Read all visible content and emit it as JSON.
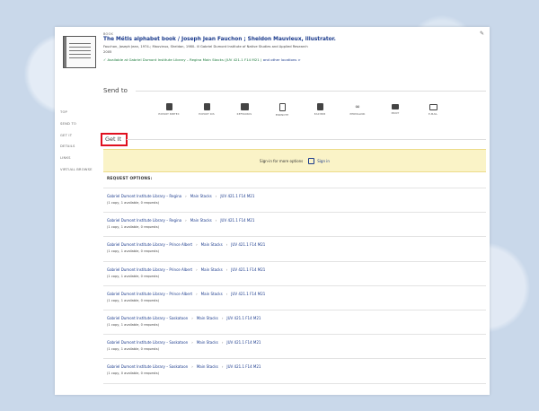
{
  "record": {
    "type": "BOOK",
    "title": "The Métis alphabet book / Joseph Jean Fauchon ; Sheldon Mauvieux, illustrator.",
    "authors": "Fauchon, Joseph Jean, 1974-; Mauvieux, Sheldon, 1980- ill Gabriel Dumont Institute of Native Studies and Applied Research",
    "year": "2005",
    "availability_prefix": "Available at Gabriel Dumont Institute Library – Regina  Main Stacks (JUV 421.1 F14 M21 )",
    "availability_link": "and other locations >"
  },
  "nav": [
    "TOP",
    "SEND TO",
    "GET IT",
    "DETAILS",
    "LINKS",
    "VIRTUAL BROWSE"
  ],
  "send_to": {
    "label": "Send to",
    "actions": [
      {
        "label": "EXPORT BIBTEX",
        "icon": "file-icon"
      },
      {
        "label": "EXPORT RIS",
        "icon": "file-icon"
      },
      {
        "label": "REFWORKS",
        "icon": "refworks-icon"
      },
      {
        "label": "ENDNOTE",
        "icon": "document-icon"
      },
      {
        "label": "EASYBIB",
        "icon": "file-icon"
      },
      {
        "label": "PERMALINK",
        "icon": "link-icon"
      },
      {
        "label": "PRINT",
        "icon": "print-icon"
      },
      {
        "label": "E-MAIL",
        "icon": "mail-icon"
      }
    ]
  },
  "get_it": {
    "label": "Get It",
    "signin_message": "Sign-in for more options",
    "signin_link": "Sign in"
  },
  "request_options_label": "REQUEST OPTIONS:",
  "holdings": [
    {
      "library": "Gabriel Dumont Institute Library – Regina",
      "location": "Main Stacks",
      "call": "JUV 421.1 F14 M21",
      "info": "(1 copy, 1 available, 0 requests)"
    },
    {
      "library": "Gabriel Dumont Institute Library – Regina",
      "location": "Main Stacks",
      "call": "JUV 421.1 F14 M21",
      "info": "(1 copy, 1 available, 0 requests)"
    },
    {
      "library": "Gabriel Dumont Institute Library – Prince Albert",
      "location": "Main Stacks",
      "call": "JUV 421.1 F14 M21",
      "info": "(1 copy, 1 available, 0 requests)"
    },
    {
      "library": "Gabriel Dumont Institute Library – Prince Albert",
      "location": "Main Stacks",
      "call": "JUV 421.1 F14 M21",
      "info": "(1 copy, 1 available, 0 requests)"
    },
    {
      "library": "Gabriel Dumont Institute Library – Prince Albert",
      "location": "Main Stacks",
      "call": "JUV 421.1 F14 M21",
      "info": "(1 copy, 1 available, 0 requests)"
    },
    {
      "library": "Gabriel Dumont Institute Library – Saskatoon",
      "location": "Main Stacks",
      "call": "JUV 421.1 F14 M21",
      "info": "(1 copy, 1 available, 0 requests)"
    },
    {
      "library": "Gabriel Dumont Institute Library – Saskatoon",
      "location": "Main Stacks",
      "call": "JUV 421.1 F14 M21",
      "info": "(1 copy, 1 available, 0 requests)"
    },
    {
      "library": "Gabriel Dumont Institute Library – Saskatoon",
      "location": "Main Stacks",
      "call": "JUV 421.1 F14 M21",
      "info": "(1 copy, 0 available, 0 requests)"
    }
  ],
  "colors": {
    "link": "#1a3a8c",
    "available": "#1a7a3a",
    "highlight": "#e0101f",
    "signin_bg": "#faf3c7"
  }
}
